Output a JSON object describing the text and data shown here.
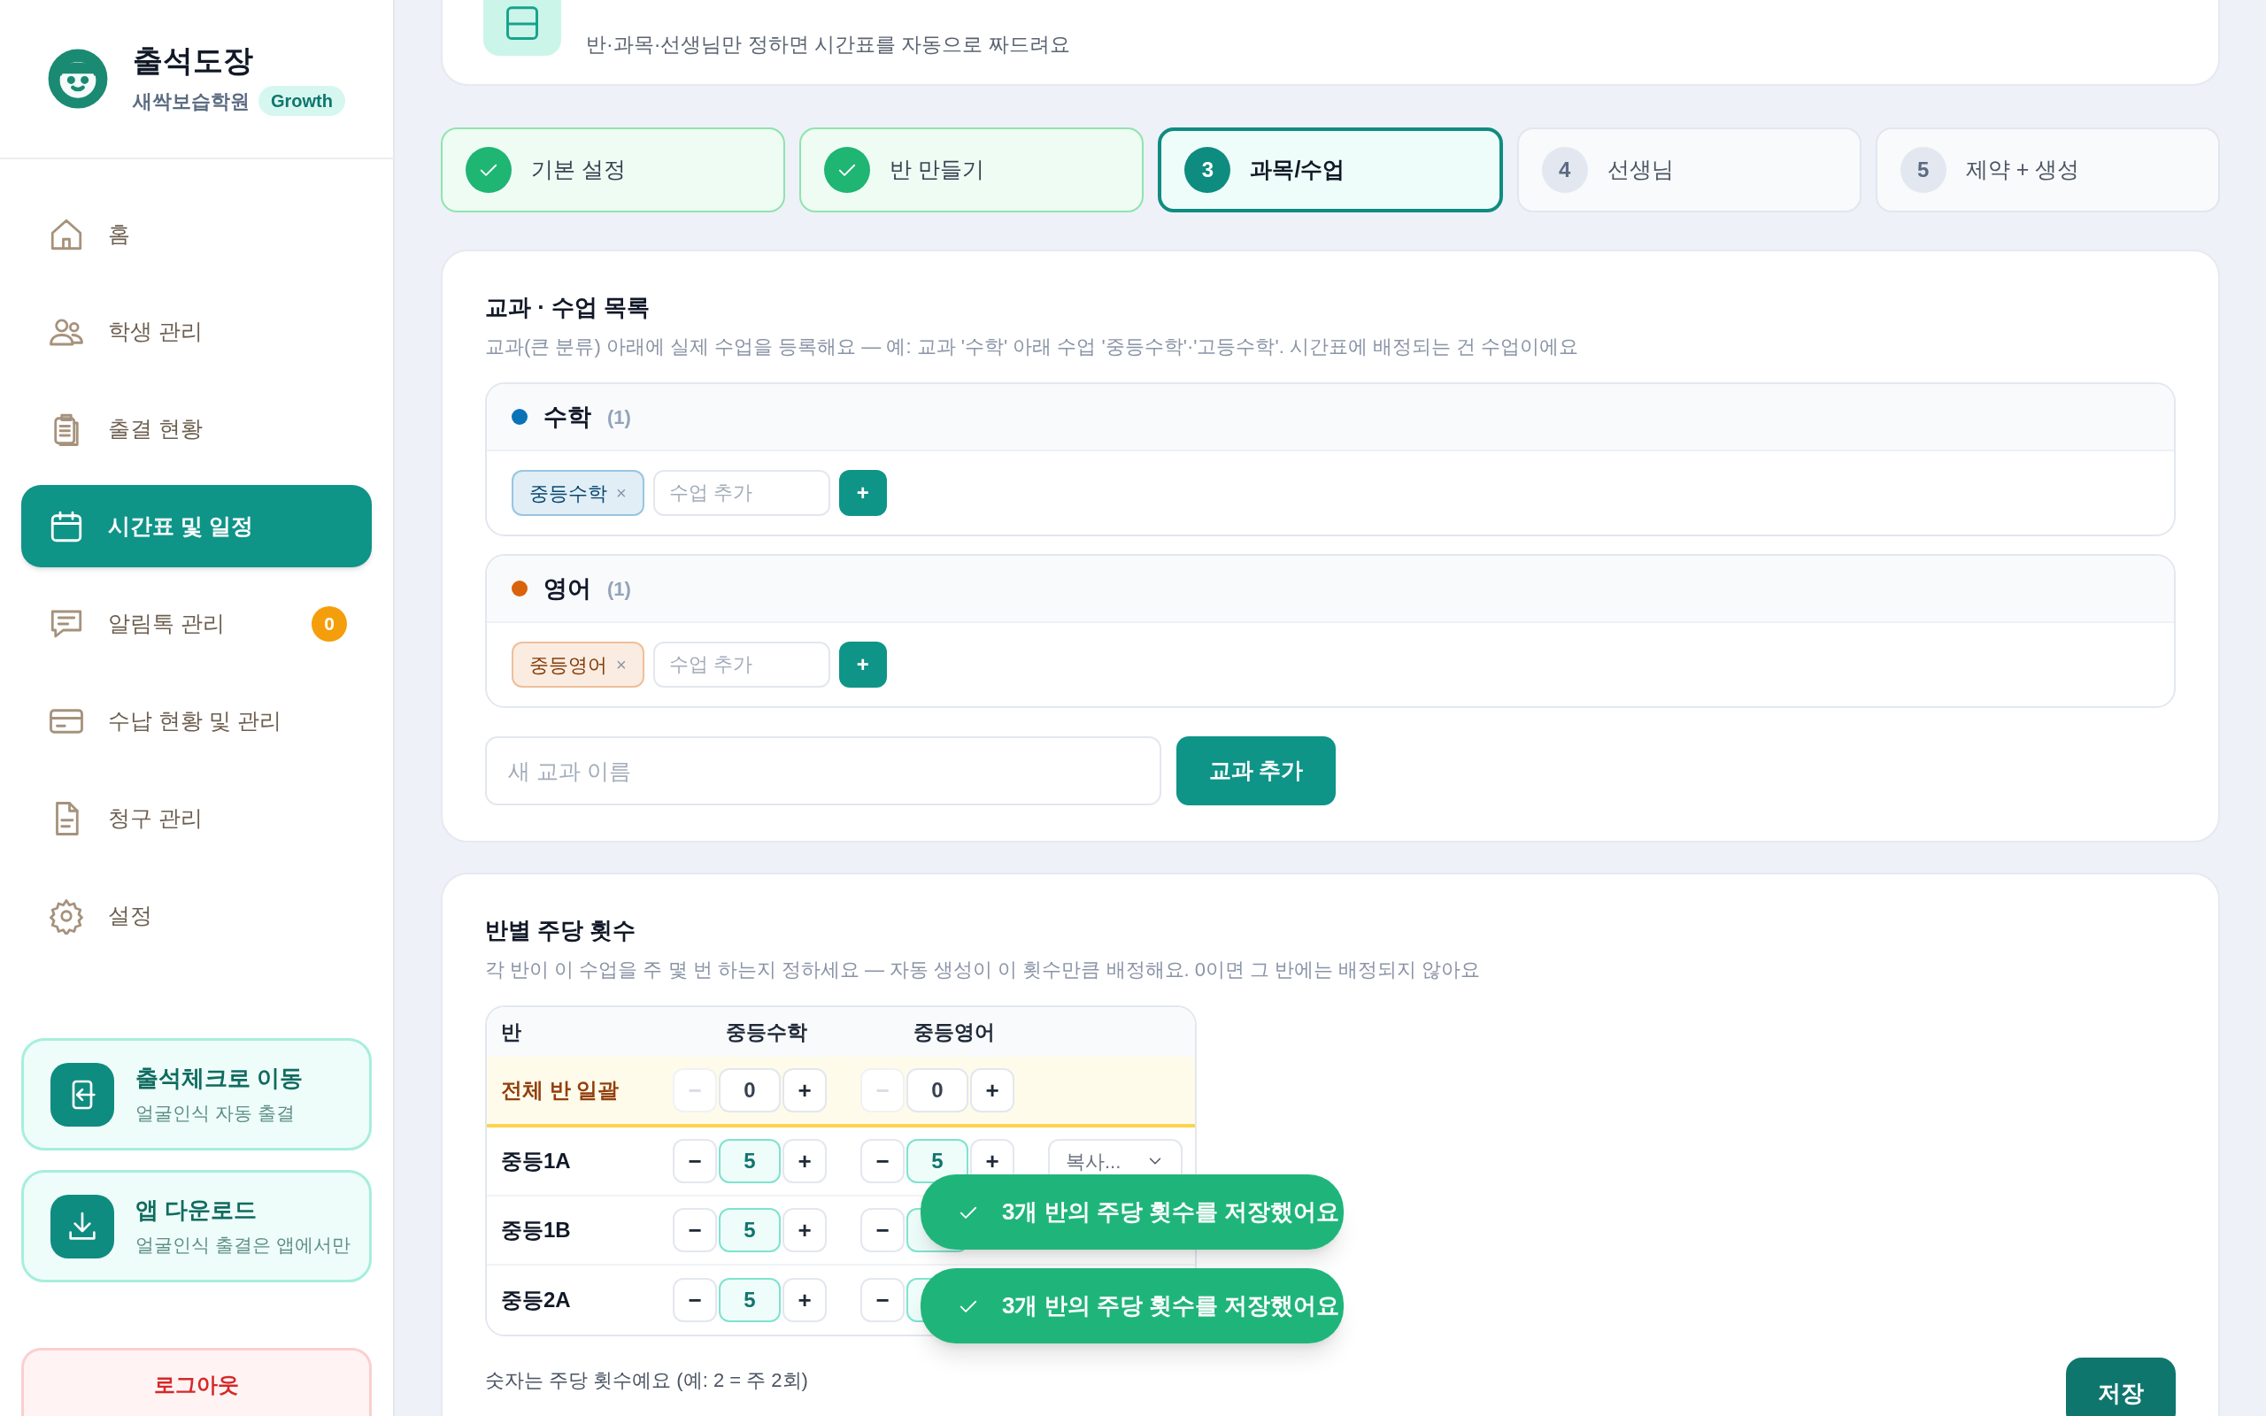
{
  "sidebar": {
    "app_name": "출석도장",
    "academy": "새싹보습학원",
    "plan": "Growth",
    "nav": [
      {
        "label": "홈",
        "selected": false
      },
      {
        "label": "학생 관리",
        "selected": false
      },
      {
        "label": "출결 현황",
        "selected": false
      },
      {
        "label": "시간표 및 일정",
        "selected": true
      },
      {
        "label": "알림톡 관리",
        "selected": false,
        "badge": "0"
      },
      {
        "label": "수납 현황 및 관리",
        "selected": false
      },
      {
        "label": "청구 관리",
        "selected": false
      },
      {
        "label": "설정",
        "selected": false
      }
    ],
    "shortcuts": [
      {
        "title": "출석체크로 이동",
        "subtitle": "얼굴인식 자동 출결"
      },
      {
        "title": "앱 다운로드",
        "subtitle": "얼굴인식 출결은 앱에서만"
      }
    ],
    "logout": "로그아웃"
  },
  "header": {
    "subtitle": "반·과목·선생님만 정하면 시간표를 자동으로 짜드려요"
  },
  "steps": [
    {
      "label": "기본 설정",
      "completed": true,
      "selected": false
    },
    {
      "label": "반 만들기",
      "completed": true,
      "selected": false
    },
    {
      "number": "3",
      "label": "과목/수업",
      "completed": false,
      "selected": true
    },
    {
      "number": "4",
      "label": "선생님",
      "completed": false,
      "selected": false
    },
    {
      "number": "5",
      "label": "제약 + 생성",
      "completed": false,
      "selected": false
    }
  ],
  "subjects_section": {
    "title": "교과 · 수업 목록",
    "description": "교과(큰 분류) 아래에 실제 수업을 등록해요 — 예: 교과 '수학' 아래 수업 '중등수학'·'고등수학'. 시간표에 배정되는 건 수업이에요",
    "subjects": [
      {
        "name": "수학",
        "count": "(1)",
        "color": "#0a73b8",
        "courses": [
          "중등수학"
        ],
        "remove": "×",
        "placeholder": "수업 추가",
        "add": "+"
      },
      {
        "name": "영어",
        "count": "(1)",
        "color": "#d9620b",
        "courses": [
          "중등영어"
        ],
        "remove": "×",
        "placeholder": "수업 추가",
        "add": "+"
      }
    ],
    "new_subject_placeholder": "새 교과 이름",
    "add_subject": "교과 추가"
  },
  "frequency_section": {
    "title": "반별 주당 횟수",
    "description": "각 반이 이 수업을 주 몇 번 하는지 정하세요 — 자동 생성이 이 횟수만큼 배정해요. 0이면 그 반에는 배정되지 않아요",
    "columns": [
      "반",
      "중등수학",
      "중등영어"
    ],
    "rows": [
      {
        "kind": "bulk",
        "label": "전체 반 일괄",
        "counts": [
          {
            "minus": "−",
            "value": "0",
            "plus": "+",
            "minus_disabled": true,
            "active": false
          },
          {
            "minus": "−",
            "value": "0",
            "plus": "+",
            "minus_disabled": true,
            "active": false
          }
        ]
      },
      {
        "kind": "class",
        "label": "중등1A",
        "counts": [
          {
            "minus": "−",
            "value": "5",
            "plus": "+",
            "minus_disabled": false,
            "active": true
          },
          {
            "minus": "−",
            "value": "5",
            "plus": "+",
            "minus_disabled": false,
            "active": true
          }
        ],
        "copy": "복사..."
      },
      {
        "kind": "class",
        "label": "중등1B",
        "counts": [
          {
            "minus": "−",
            "value": "5",
            "plus": "+",
            "minus_disabled": false,
            "active": true
          },
          {
            "minus": "−",
            "minus_disabled": false,
            "active": true
          }
        ]
      },
      {
        "kind": "class",
        "label": "중등2A",
        "counts": [
          {
            "minus": "−",
            "value": "5",
            "plus": "+",
            "minus_disabled": false,
            "active": true
          },
          {
            "minus": "−",
            "minus_disabled": false,
            "active": true
          }
        ]
      }
    ],
    "note": "숫자는 주당 횟수예요 (예: 2 = 주 2회)",
    "save": "저장"
  },
  "toasts": [
    "3개 반의 주당 횟수를 저장했어요",
    "3개 반의 주당 횟수를 저장했어요"
  ]
}
